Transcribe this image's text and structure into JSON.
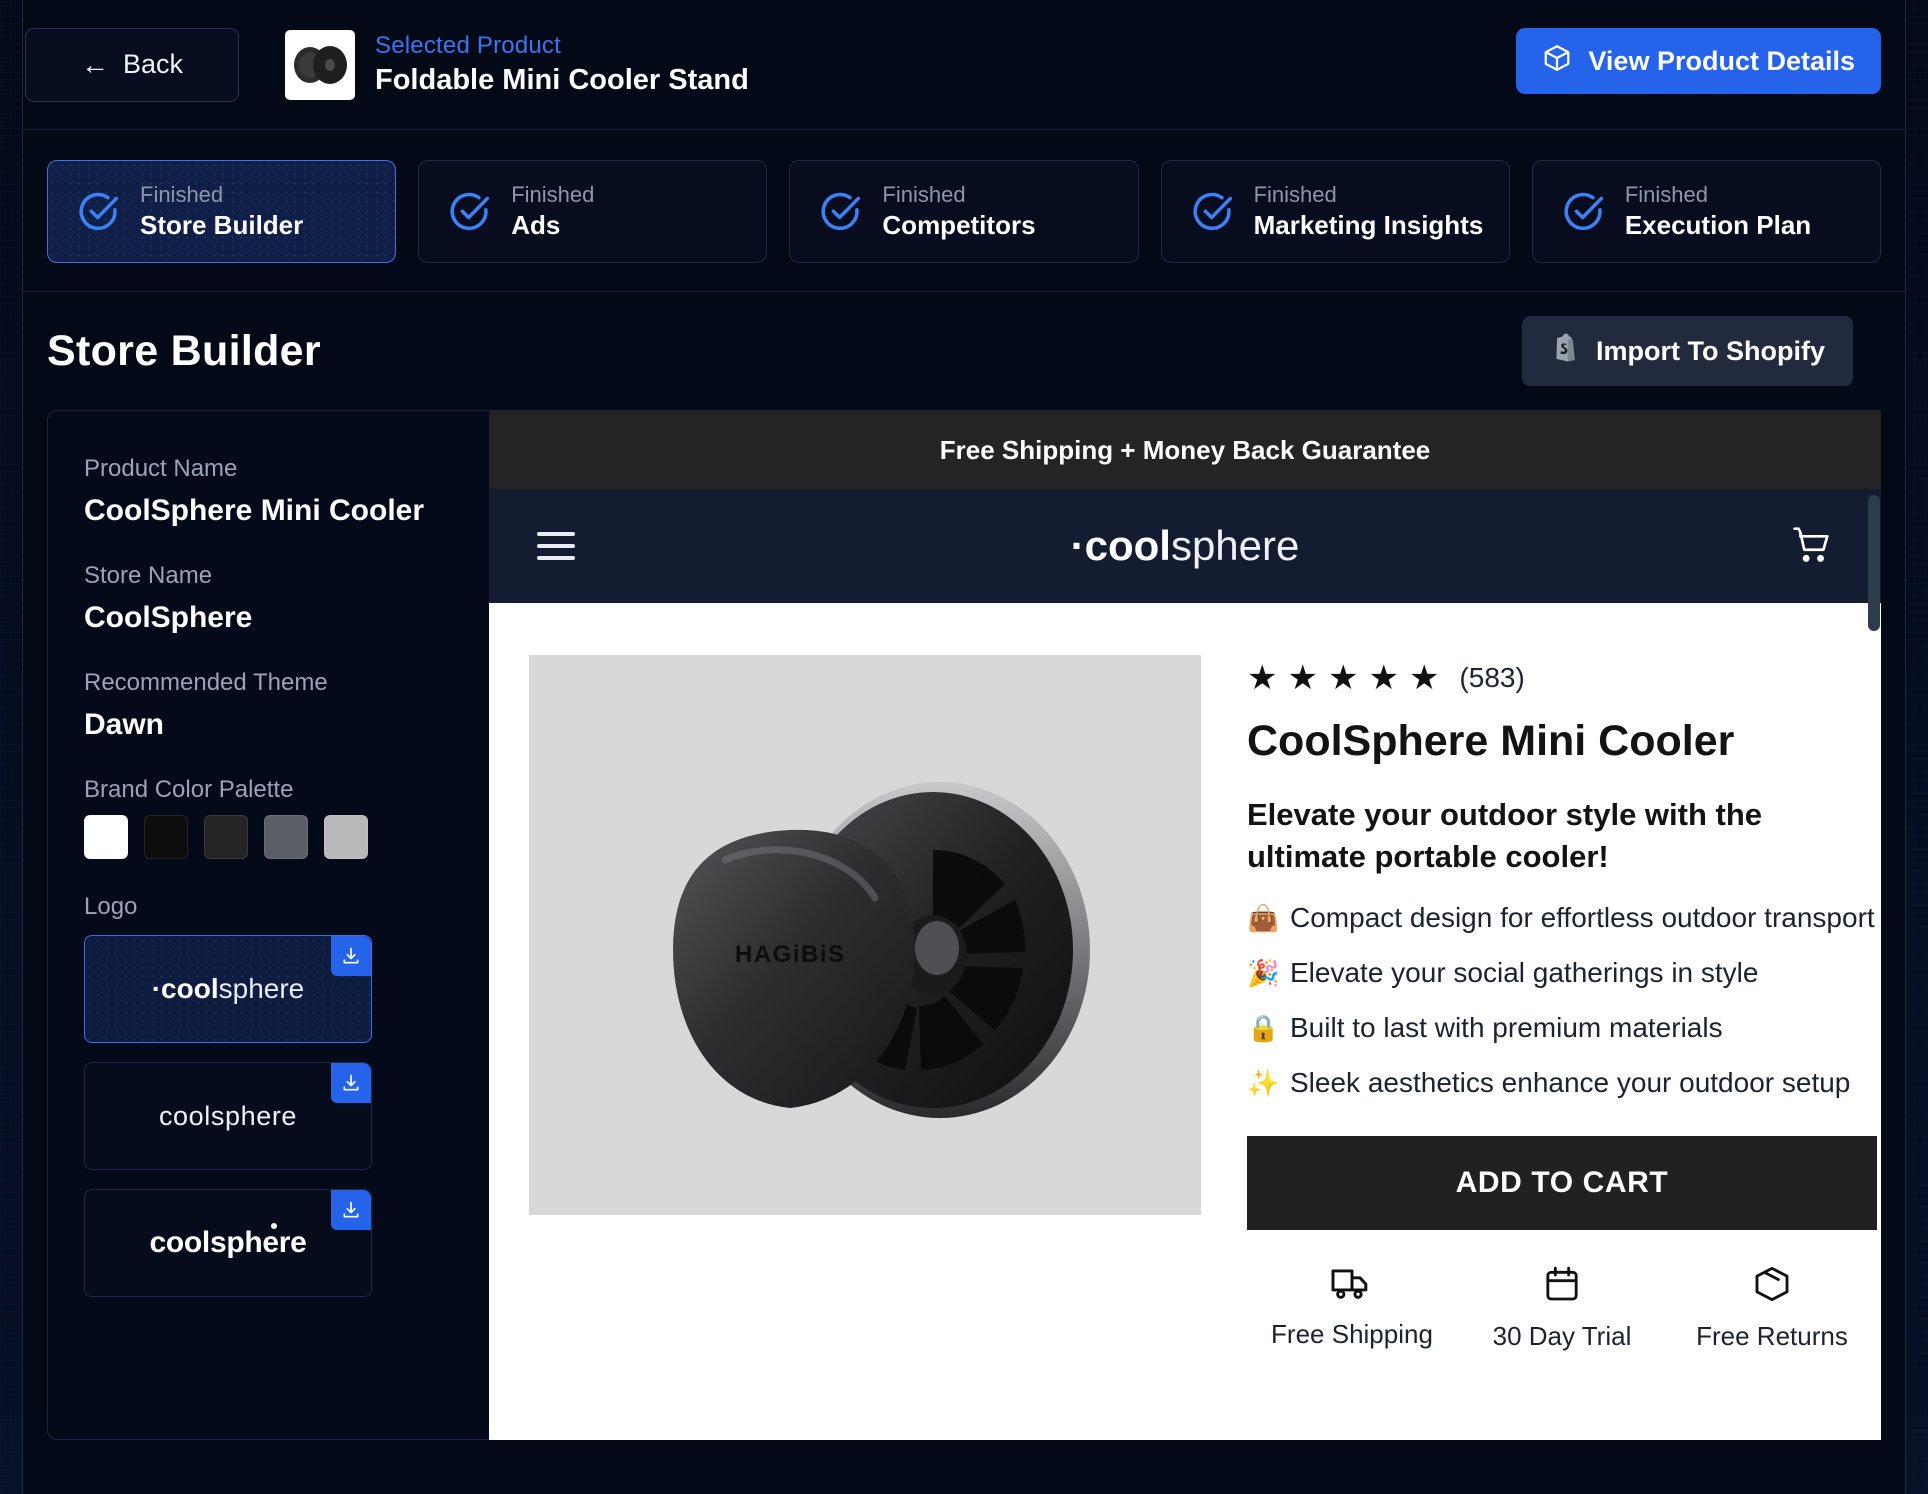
{
  "topbar": {
    "back_label": "Back",
    "back_icon": "arrow-left-icon",
    "selected_label": "Selected Product",
    "selected_product": "Foldable Mini Cooler Stand",
    "view_details_label": "View Product Details",
    "view_details_icon": "box-icon"
  },
  "steps": [
    {
      "status": "Finished",
      "name": "Store Builder",
      "active": true
    },
    {
      "status": "Finished",
      "name": "Ads",
      "active": false
    },
    {
      "status": "Finished",
      "name": "Competitors",
      "active": false
    },
    {
      "status": "Finished",
      "name": "Marketing Insights",
      "active": false
    },
    {
      "status": "Finished",
      "name": "Execution Plan",
      "active": false
    }
  ],
  "section": {
    "title": "Store Builder",
    "import_label": "Import To Shopify",
    "import_icon": "shopify-bag-icon"
  },
  "sidebar": {
    "product_name_label": "Product Name",
    "product_name_value": "CoolSphere Mini Cooler",
    "store_name_label": "Store Name",
    "store_name_value": "CoolSphere",
    "theme_label": "Recommended Theme",
    "theme_value": "Dawn",
    "palette_label": "Brand Color Palette",
    "palette": [
      "#ffffff",
      "#0d0d0d",
      "#242424",
      "#5a5f66",
      "#b9b9b9"
    ],
    "logo_label": "Logo",
    "logos": [
      {
        "text_bold": "·cool",
        "text_light": "sphere",
        "variant": "mixed",
        "selected": true,
        "download_icon": "download-icon"
      },
      {
        "text_bold": "",
        "text_light": "coolsphere",
        "variant": "light",
        "selected": false,
        "download_icon": "download-icon"
      },
      {
        "text_bold": "coolsphere",
        "text_light": "",
        "variant": "bold",
        "selected": false,
        "download_icon": "download-icon"
      }
    ]
  },
  "preview": {
    "announcement": "Free Shipping + Money Back Guarantee",
    "nav": {
      "menu_icon": "hamburger-menu-icon",
      "logo_bold": "·cool",
      "logo_light": "sphere",
      "cart_icon": "shopping-cart-icon"
    },
    "product": {
      "image_brand": "HAGiBiS",
      "image_alt": "black foldable mini cooler stand, two discs",
      "stars": 5,
      "star_glyph": "★",
      "review_count": "(583)",
      "title": "CoolSphere Mini Cooler",
      "subtitle": "Elevate your outdoor style with the ultimate portable cooler!",
      "bullets": [
        {
          "emoji": "👜",
          "text": "Compact design for effortless outdoor transport"
        },
        {
          "emoji": "🎉",
          "text": "Elevate your social gatherings in style"
        },
        {
          "emoji": "🔒",
          "text": "Built to last with premium materials"
        },
        {
          "emoji": "✨",
          "text": "Sleek aesthetics enhance your outdoor setup"
        }
      ],
      "add_to_cart": "ADD TO CART",
      "badges": [
        {
          "icon": "truck-icon",
          "label": "Free Shipping"
        },
        {
          "icon": "calendar-icon",
          "label": "30 Day Trial"
        },
        {
          "icon": "box-icon",
          "label": "Free Returns"
        }
      ]
    }
  },
  "colors": {
    "accent_blue": "#2563eb",
    "step_active_bg": "#101f47",
    "announce_bg": "#242424",
    "store_nav_bg": "#141c31",
    "atc_bg": "#212121"
  }
}
